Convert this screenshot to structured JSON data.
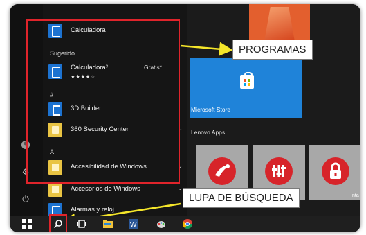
{
  "start_menu": {
    "list": {
      "top_item": "Calculadora",
      "suggested_header": "Sugerido",
      "suggested_item": {
        "label": "Calculadora³",
        "badge": "Gratis*",
        "stars": "★★★★☆"
      },
      "section_hash": "#",
      "items_hash": [
        "3D Builder",
        "360 Security Center"
      ],
      "section_a": "A",
      "items_a": [
        "Accesibilidad de Windows",
        "Accesorios de Windows",
        "Alarmas y reloj"
      ]
    },
    "tiles": {
      "store_label": "Microsoft Store",
      "group_label": "Lenovo Apps",
      "tile_sub_label": "nta"
    }
  },
  "callouts": {
    "programs": "PROGRAMAS",
    "search": "LUPA DE BÚSQUEDA"
  },
  "colors": {
    "highlight": "#e0242b",
    "arrow": "#f5e62a",
    "store_tile": "#1f83d9",
    "calc_icon": "#1d73d1",
    "folder_icon": "#e9c443",
    "lenovo_red": "#d7242a"
  }
}
